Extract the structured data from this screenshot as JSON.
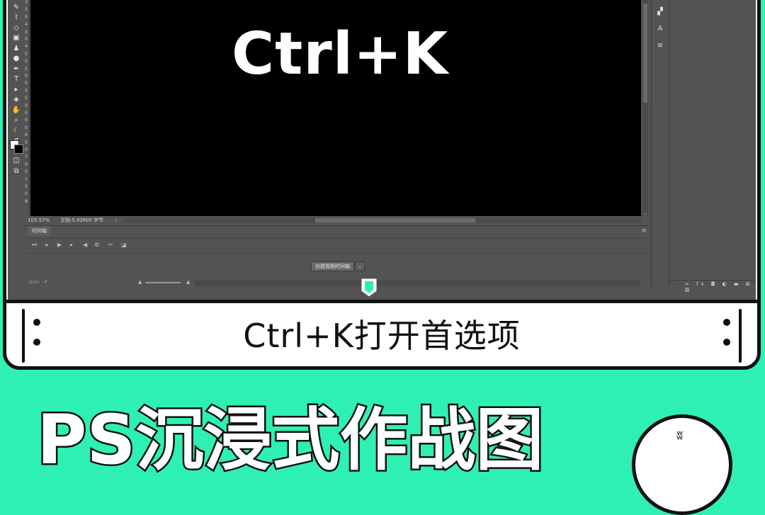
{
  "app": {
    "canvas_text": "Ctrl+K",
    "status": {
      "zoom": "103.57%",
      "doc_info": "文档:5.93M/0 字节",
      "caret": "›"
    },
    "timeline": {
      "tab_label": "时间轴",
      "create_button": "创建视频时间轴",
      "menu_icon": "≡"
    },
    "ruler_marks": [
      "3",
      "5",
      "0",
      "4",
      "0",
      "0",
      "4",
      "5",
      "0",
      "5",
      "0",
      "0",
      "5",
      "5",
      "0",
      "6",
      "0",
      "0",
      "6",
      "5",
      "0",
      "7",
      "0",
      "0",
      "7",
      "5",
      "0",
      "8"
    ],
    "toolbar_icons": [
      "brush-icon",
      "healing-icon",
      "eraser-icon",
      "gradient-icon",
      "blur-icon",
      "dodge-icon",
      "pen-icon",
      "type-icon",
      "path-selection-icon",
      "shape-icon",
      "hand-icon",
      "zoom-icon",
      "edit-toolbar-icon",
      "swap-colors-icon",
      "quick-mask-icon",
      "screen-mode-icon"
    ],
    "right_strip_icons": [
      "color-icon",
      "swatches-icon",
      "character-icon",
      "adjustments-icon"
    ]
  },
  "caption": {
    "text": "Ctrl+K打开首选项"
  },
  "title": {
    "text": "PS沉浸式作战图"
  },
  "colors": {
    "background": "#2ef0b4",
    "ps_gray": "#535353",
    "marker": "#2ef0b4"
  }
}
